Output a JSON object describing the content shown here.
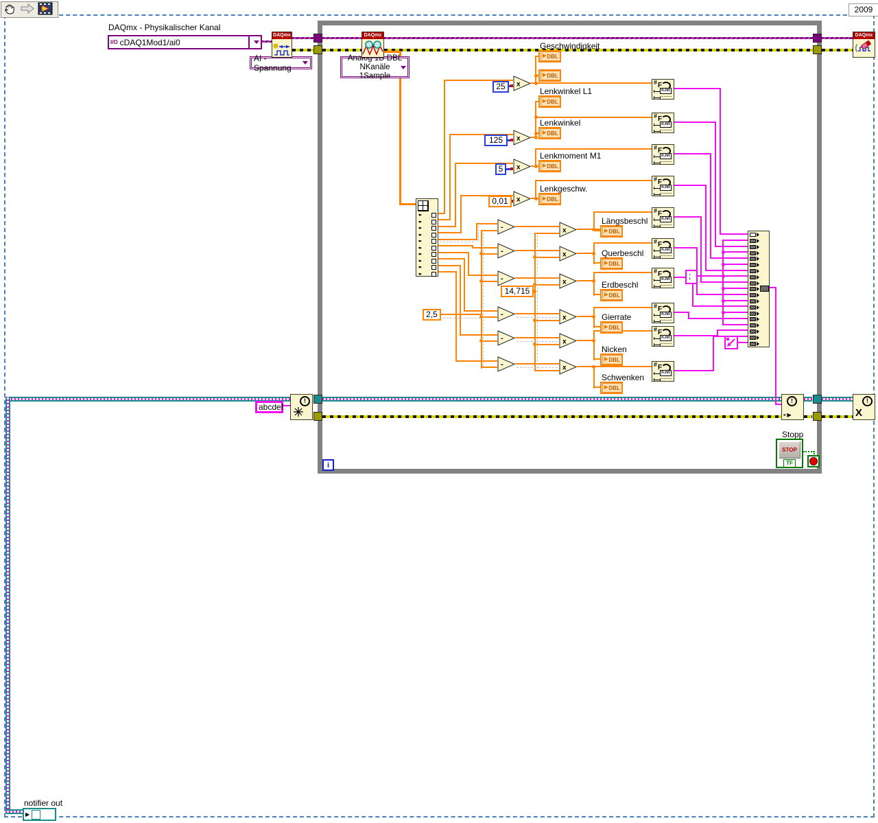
{
  "window": {
    "version": "2009"
  },
  "toolbar": {
    "icons": [
      "hand-tool",
      "select-arrow",
      "vi-icon"
    ]
  },
  "daqmx": {
    "banner": "DAQmx",
    "physical_channel_label": "DAQmx - Physikalischer Kanal",
    "physical_channel_value": "cDAQ1Mod1/ai0",
    "io_glyph": "I/O",
    "measurement_type": "AI - Spannung",
    "read_mode_line1": "Analog 1D DBL",
    "read_mode_line2": "NKanäle 1Sample"
  },
  "constants": {
    "speed_gain": "25",
    "angle_gain": "125",
    "torque_gain": "5",
    "rate_gain": "0,01",
    "accel_scale": "14,715",
    "accel_offset": "2,5",
    "separator": ";",
    "notifier_name": "abcdef"
  },
  "ops": {
    "multiply": "x",
    "subtract": "-"
  },
  "format_node": {
    "hash": "#",
    "f": "F",
    "pattern": "n.nn"
  },
  "indicators": [
    {
      "label": "Geschwindigkeit",
      "type": "DBL"
    },
    {
      "label": "",
      "type": "DBL"
    },
    {
      "label": "Lenkwinkel L1",
      "type": "DBL"
    },
    {
      "label": "Lenkwinkel",
      "type": "DBL"
    },
    {
      "label": "Lenkmoment M1",
      "type": "DBL"
    },
    {
      "label": "Lenkgeschw.",
      "type": "DBL"
    },
    {
      "label": "Längsbeschl",
      "type": "DBL"
    },
    {
      "label": "Querbeschl",
      "type": "DBL"
    },
    {
      "label": "Erdbeschl",
      "type": "DBL"
    },
    {
      "label": "Gierrate",
      "type": "DBL"
    },
    {
      "label": "Nicken",
      "type": "DBL"
    },
    {
      "label": "Schwenken",
      "type": "DBL"
    }
  ],
  "loop": {
    "iteration": "i"
  },
  "stop": {
    "label": "Stopp",
    "button_text": "STOP",
    "terminal": "TF"
  },
  "notifier": {
    "out_label": "notifier out"
  },
  "glyphs": {
    "bang": "!",
    "send": "▪○▶",
    "release": "X",
    "dbl_arrow": "▶",
    "index_row": "▪▸",
    "notifier_stub": "▶"
  },
  "colors": {
    "orange_dbl": "#FF8200",
    "blue_int": "#2840D8",
    "purple_daqmx": "#800080",
    "pink_string": "#F10FF1",
    "teal_refnum": "#1A8C8C",
    "olive_error": "#9B9B00",
    "green_bool": "#009800",
    "loop_gray": "#828282",
    "error_yellow": "#D9D900",
    "node_fill": "#FCF6CE",
    "banner_red": "#B40000",
    "frame_dash_blue": "#4880B8"
  }
}
